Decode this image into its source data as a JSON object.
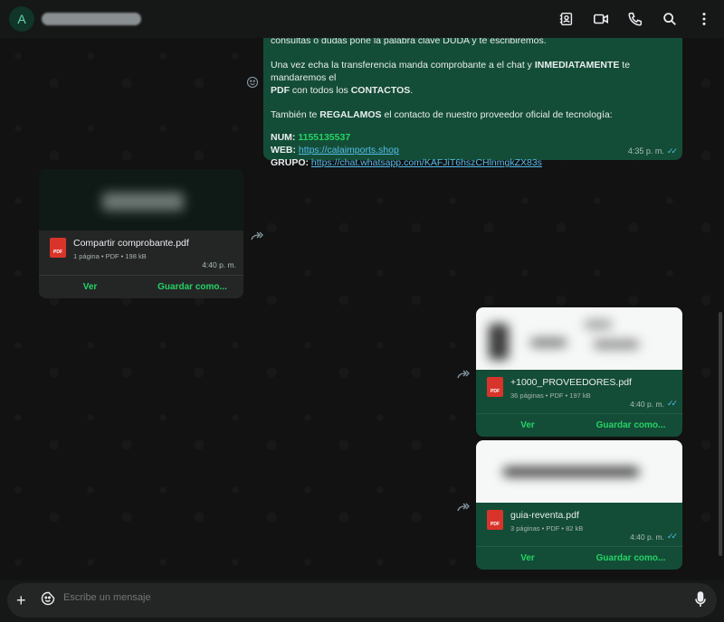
{
  "header": {
    "avatar_letter": "A",
    "icons": [
      "contacts-icon",
      "video-call-icon",
      "phone-icon",
      "search-icon",
      "more-icon"
    ]
  },
  "top_message": {
    "line0": "consultas o dudas pone la palabra clave DUDA y te escribiremos.",
    "p1_a": "Una vez echa la transferencia manda comprobante a el chat y ",
    "p1_b": "INMEDIATAMENTE",
    "p1_c": " te mandaremos el ",
    "p1_d": "PDF",
    "p1_e": " con todos los ",
    "p1_f": "CONTACTOS",
    "p1_g": ".",
    "p2_a": "También te ",
    "p2_b": "REGALAMOS",
    "p2_c": " el contacto de nuestro proveedor oficial de tecnología:",
    "num_label": "NUM:",
    "num_value": "1155135537",
    "web_label": "WEB:",
    "web_value": "https://calaimports.shop",
    "group_label": "GRUPO:",
    "group_value": "https://chat.whatsapp.com/KAFJiT6hszCHlnmgkZX83s",
    "time": "4:35 p. m."
  },
  "docs": [
    {
      "name": "Compartir comprobante.pdf",
      "meta": "1 página • PDF • 198 kB",
      "time": "4:40 p. m.",
      "view": "Ver",
      "save": "Guardar como..."
    },
    {
      "name": "+1000_PROVEEDORES.pdf",
      "meta": "36 páginas • PDF • 197 kB",
      "time": "4:40 p. m.",
      "view": "Ver",
      "save": "Guardar como..."
    },
    {
      "name": "guia-reventa.pdf",
      "meta": "3 páginas • PDF • 82 kB",
      "time": "4:40 p. m.",
      "view": "Ver",
      "save": "Guardar como..."
    }
  ],
  "pdf_badge": "PDF",
  "composer": {
    "placeholder": "Escribe un mensaje"
  }
}
